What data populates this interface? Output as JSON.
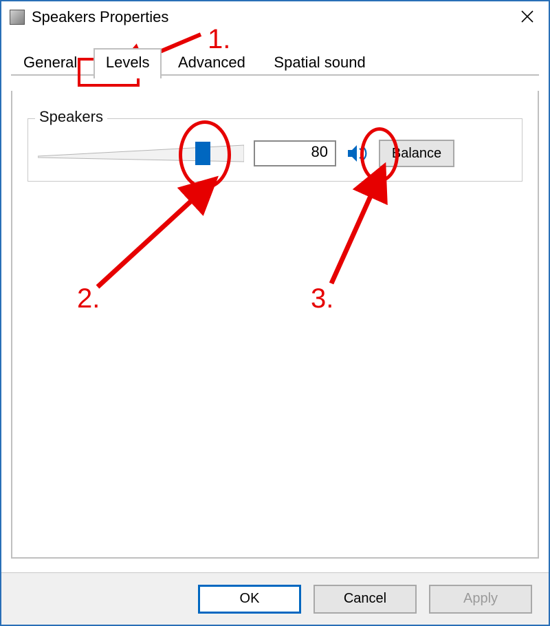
{
  "window": {
    "title": "Speakers Properties"
  },
  "tabs": {
    "items": [
      {
        "label": "General"
      },
      {
        "label": "Levels"
      },
      {
        "label": "Advanced"
      },
      {
        "label": "Spatial sound"
      }
    ],
    "active_index": 1
  },
  "levels": {
    "group_title": "Speakers",
    "volume_value": "80",
    "volume_percent": 80,
    "balance_label": "Balance"
  },
  "buttons": {
    "ok": "OK",
    "cancel": "Cancel",
    "apply": "Apply"
  },
  "annotations": {
    "step1": "1.",
    "step2": "2.",
    "step3": "3."
  },
  "colors": {
    "annotation": "#e60000",
    "accent": "#0067c0"
  }
}
